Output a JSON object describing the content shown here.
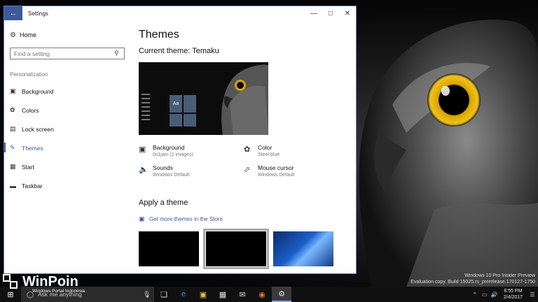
{
  "window": {
    "title": "Settings"
  },
  "sidebar": {
    "home_label": "Home",
    "search_placeholder": "Find a setting",
    "section_label": "Personalization",
    "items": [
      {
        "label": "Background",
        "icon": "image-icon"
      },
      {
        "label": "Colors",
        "icon": "palette-icon"
      },
      {
        "label": "Lock screen",
        "icon": "lock-screen-icon"
      },
      {
        "label": "Themes",
        "icon": "brush-icon",
        "active": true
      },
      {
        "label": "Start",
        "icon": "start-menu-icon"
      },
      {
        "label": "Taskbar",
        "icon": "taskbar-icon"
      }
    ]
  },
  "main": {
    "title": "Themes",
    "current_theme": "Current theme: Temaku",
    "preview_tile_text": "Aa",
    "props": [
      {
        "name": "Background",
        "value": "0s1jam (1 images)",
        "icon": "image-icon"
      },
      {
        "name": "Color",
        "value": "Steel blue",
        "icon": "palette-icon"
      },
      {
        "name": "Sounds",
        "value": "Windows Default",
        "icon": "speaker-icon"
      },
      {
        "name": "Mouse cursor",
        "value": "Windows Default",
        "icon": "cursor-icon"
      }
    ],
    "apply_title": "Apply a theme",
    "store_link": "Get more themes in the Store"
  },
  "taskbar": {
    "cortana_placeholder": "Ask me anything",
    "clock_time": "8:55 PM",
    "clock_date": "2/4/2017"
  },
  "watermark": {
    "line1": "Windows 10 Pro Insider Preview",
    "line2": "Evaluation copy. Build 15025.rs_prerelease.170127-1750"
  },
  "logo": {
    "name": "WinPoin",
    "subtitle": "Windows Portal Indonesia"
  },
  "colors": {
    "accent": "#3d5a99",
    "taskbar": "#101010"
  }
}
